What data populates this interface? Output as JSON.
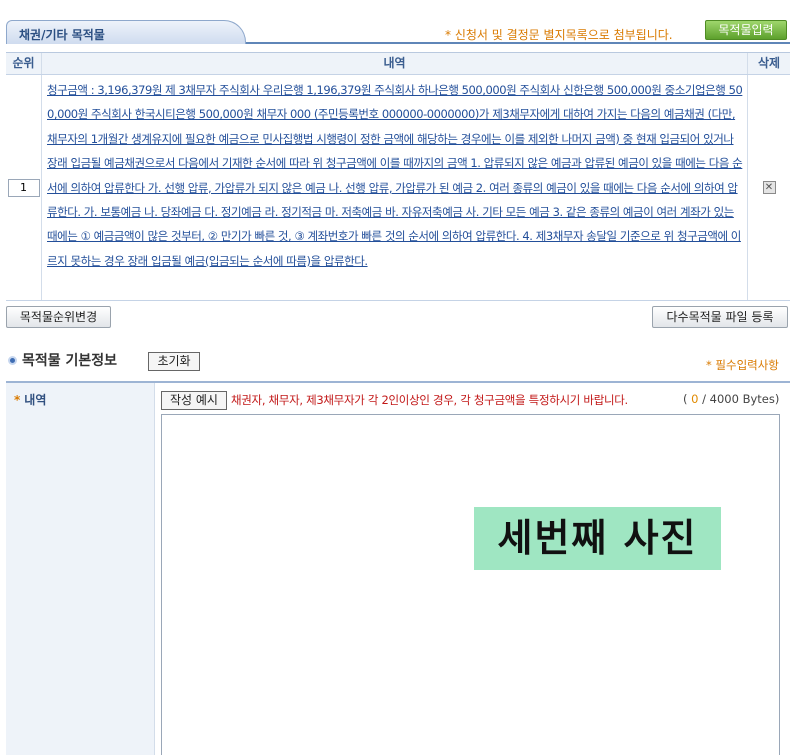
{
  "header": {
    "tab_label": "채권/기타 목적물",
    "notice": "* 신청서 및 결정문 별지목록으로 첨부됩니다.",
    "add_button": "목적물입력"
  },
  "table": {
    "columns": [
      "순위",
      "내역",
      "삭제"
    ],
    "rows": [
      {
        "order": "1",
        "text": "청구금액 : 3,196,379원 제 3채무자 주식회사 우리은행 1,196,379원 주식회사 하나은행 500,000원 주식회사 신한은행 500,000원 중소기업은행 500,000원 주식회사 한국시티은행 500,000원 채무자 000 (주민등록번호 000000-0000000)가 제3채무자에게 대하여 가지는 다음의 예금채권 (다만, 채무자의 1개월간 생계유지에 필요한 예금으로 민사집행법 시행령이 정한 금액에 해당하는 경우에는 이를 제외한 나머지 금액) 중 현재 입금되어 있거나 장래 입금될 예금채권으로서 다음에서 기재한 순서에 따라 위 청구금액에 이를 때까지의 금액 1. 압류되지 않은 예금과 압류된 예금이 있을 때에는 다음 순서에 의하여 압류한다 가. 선행 압류, 가압류가 되지 않은 예금 나. 선행 압류, 가압류가 된 예금 2. 여러 종류의 예금이 있을 때에는 다음 순서에 의하여 압류한다. 가. 보통예금 나. 당좌예금 다. 정기예금 라. 정기적금 마. 저축예금 바. 자유저축예금 사. 기타 모든 예금 3. 같은 종류의 예금이 여러 계좌가 있는 때에는 ① 예금금액이 많은 것부터, ② 만기가 빠른 것, ③ 계좌번호가 빠른 것의 순서에 의하여 압류한다. 4. 제3채무자 송달일 기준으로 위 청구금액에 이르지 못하는 경우 장래 입금될 예금(입금되는 순서에 따름)을 압류한다."
      }
    ]
  },
  "actions": {
    "reorder_button": "목적물순위변경",
    "upload_button": "다수목적물 파일 등록"
  },
  "basic_info": {
    "title": "목적물 기본정보",
    "reset_button": "초기화",
    "required_note": "* 필수입력사항",
    "field_label": "내역",
    "field_star": "*",
    "example_button": "작성 예시",
    "warning": "채권자, 채무자, 제3채무자가 각 2인이상인 경우, 각 청구금액을 특정하시기 바랍니다.",
    "bytes_open": "(",
    "bytes_current": "0",
    "bytes_max": "/ 4000 Bytes)",
    "textarea_value": ""
  },
  "overlay": {
    "text": "세번째 사진",
    "color": "#9fe6c2"
  }
}
